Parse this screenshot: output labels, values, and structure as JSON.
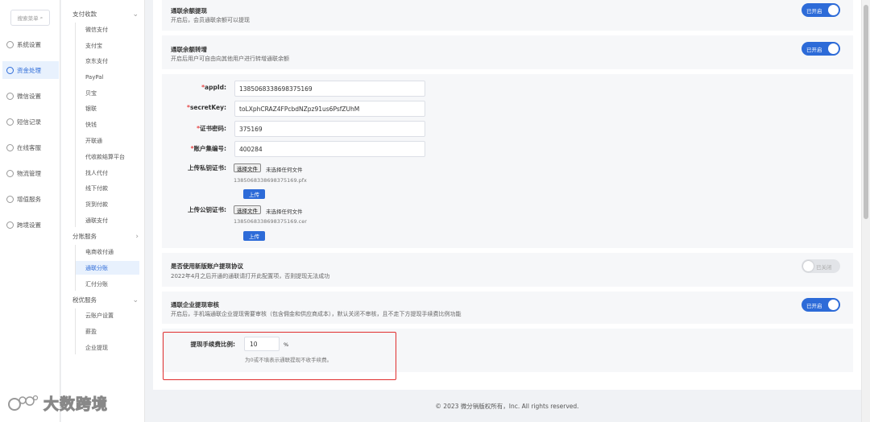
{
  "nav": {
    "search_placeholder": "搜索菜单",
    "items": [
      {
        "label": "系统设置",
        "icon": "gear-icon"
      },
      {
        "label": "资金处理",
        "icon": "money-icon"
      },
      {
        "label": "微信设置",
        "icon": "wechat-icon"
      },
      {
        "label": "短信记录",
        "icon": "message-icon"
      },
      {
        "label": "在线客服",
        "icon": "service-icon"
      },
      {
        "label": "物流管理",
        "icon": "truck-icon"
      },
      {
        "label": "增值服务",
        "icon": "chart-icon"
      },
      {
        "label": "跨境设置",
        "icon": "globe-icon"
      }
    ]
  },
  "submenu": {
    "groups": [
      {
        "label": "支付收款",
        "items": [
          "微信支付",
          "支付宝",
          "京东支付",
          "PayPal",
          "贝宝",
          "银联",
          "快钱",
          "开联通",
          "代收款结算平台",
          "找人代付",
          "线下付款",
          "货到付款",
          "通联支付"
        ]
      },
      {
        "label": "分账服务",
        "items": [
          "电商收付通",
          "通联分账",
          "汇付分账"
        ]
      },
      {
        "label": "税优服务",
        "items": [
          "云账户设置",
          "薪盈",
          "企业提现"
        ]
      }
    ]
  },
  "settings": {
    "balance_withdraw": {
      "title": "通联余额提现",
      "desc": "开启后，会员通联余额可以提现",
      "state": "已开启"
    },
    "balance_transfer": {
      "title": "通联余额转增",
      "desc": "开启后用户可自由向其他用户进行转增通联余额",
      "state": "已开启"
    },
    "form": {
      "appid_label": "appId:",
      "appid_value": "1385068338698375169",
      "secret_label": "secretKey:",
      "secret_value": "toLXphCRAZ4FPcbdNZpz91us6PsfZUhM",
      "cert_pwd_label": "证书密码:",
      "cert_pwd_value": "375169",
      "account_label": "账户集编号:",
      "account_value": "400284",
      "private_cert_label": "上传私钥证书:",
      "private_cert_file": "1385068338698375169.pfx",
      "public_cert_label": "上传公钥证书:",
      "public_cert_file": "1385068338698375169.cer",
      "choose_file": "选择文件",
      "no_file": "未选择任何文件",
      "upload": "上传"
    },
    "new_protocol": {
      "title": "是否使用新版账户提现协议",
      "desc": "2022年4月之后开通的通联请打开此配置项，否则提现无法成功",
      "state": "已关闭"
    },
    "enterprise_audit": {
      "title": "通联企业提现审核",
      "desc": "开启后，手机端通联企业提现需要审核（包含佣金和供应商成本），默认关闭不审核，且不走下方提现手续费比例功能",
      "state": "已开启"
    },
    "fee": {
      "label": "提现手续费比例:",
      "value": "10",
      "unit": "%",
      "hint": "为0或不填表示通联提现不收手续费。"
    }
  },
  "footer": "© 2023 微分销版权所有，Inc. All rights reserved.",
  "watermark": "大数跨境",
  "colors": {
    "accent": "#2d6bd8",
    "highlight_border": "#e02e2e"
  }
}
